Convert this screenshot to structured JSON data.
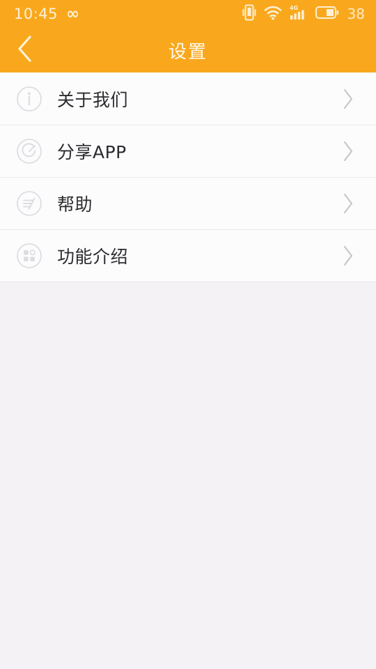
{
  "status_bar": {
    "time": "10:45",
    "infinity_label": "∞",
    "battery_percent": "38",
    "icons": [
      "vibrate-icon",
      "wifi-icon",
      "signal-4g-icon",
      "battery-icon"
    ],
    "signal_label": "4G",
    "background_color": "#f9a81d",
    "text_color": "#fdf0d6"
  },
  "title_bar": {
    "title": "设置",
    "back_icon": "chevron-left-icon",
    "background_color": "#f9a81d",
    "title_color": "#fffaf0"
  },
  "settings_list": {
    "rows": [
      {
        "label": "关于我们",
        "icon": "info-circle-icon",
        "chevron": "chevron-right-icon"
      },
      {
        "label": "分享APP",
        "icon": "share-circle-icon",
        "chevron": "chevron-right-icon"
      },
      {
        "label": "帮助",
        "icon": "help-lines-circle-icon",
        "chevron": "chevron-right-icon"
      },
      {
        "label": "功能介绍",
        "icon": "apps-grid-circle-icon",
        "chevron": "chevron-right-icon"
      }
    ],
    "row_background_color": "#fdfcfd",
    "divider_color": "#ebe9ee",
    "label_color": "#2b2b2f",
    "icon_color": "#dcdade"
  },
  "page": {
    "background_color": "#f4f2f5"
  }
}
